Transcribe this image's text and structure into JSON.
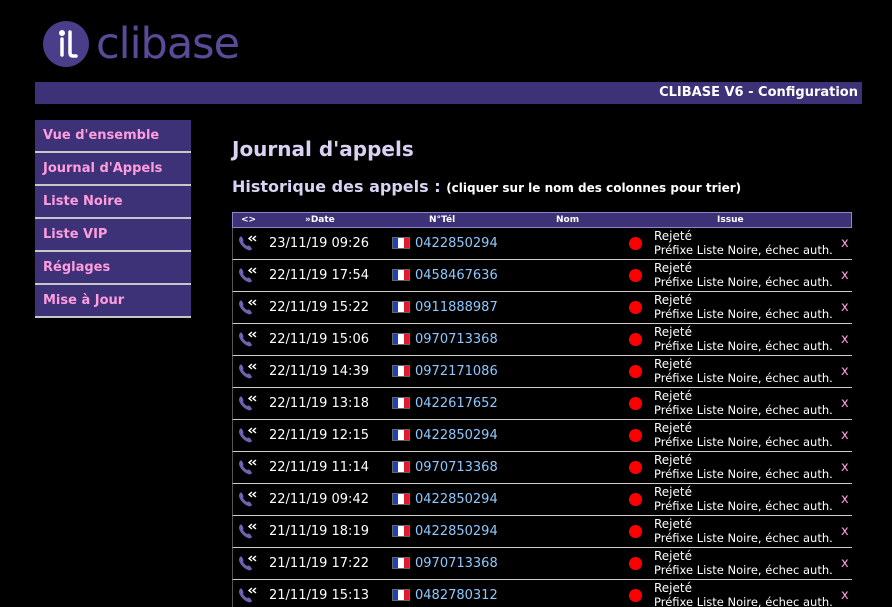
{
  "app": {
    "logo_text": "clibase",
    "title": "CLIBASE V6 - Configuration",
    "accent": "#3d3178",
    "link_pink": "#ff9ddd",
    "number_blue": "#8ec8ff"
  },
  "sidebar": {
    "items": [
      {
        "label": "Vue d'ensemble"
      },
      {
        "label": "Journal d'Appels"
      },
      {
        "label": "Liste Noire"
      },
      {
        "label": "Liste VIP"
      },
      {
        "label": "Réglages"
      },
      {
        "label": "Mise à Jour"
      }
    ]
  },
  "main": {
    "title": "Journal d'appels",
    "subtitle": "Historique des appels :",
    "subtitle_hint": "(cliquer sur le nom des colonnes pour trier)"
  },
  "table": {
    "headers": {
      "direction": "<>",
      "date": "»Date",
      "phone": "N°Tél",
      "name": "Nom",
      "issue": "Issue"
    },
    "rows": [
      {
        "date": "23/11/19 09:26",
        "phone": "0422850294",
        "name": "",
        "status": "Rejeté",
        "detail": "Préfixe Liste Noire, échec auth.",
        "delete": "x"
      },
      {
        "date": "22/11/19 17:54",
        "phone": "0458467636",
        "name": "",
        "status": "Rejeté",
        "detail": "Préfixe Liste Noire, échec auth.",
        "delete": "x"
      },
      {
        "date": "22/11/19 15:22",
        "phone": "0911888987",
        "name": "",
        "status": "Rejeté",
        "detail": "Préfixe Liste Noire, échec auth.",
        "delete": "x"
      },
      {
        "date": "22/11/19 15:06",
        "phone": "0970713368",
        "name": "",
        "status": "Rejeté",
        "detail": "Préfixe Liste Noire, échec auth.",
        "delete": "x"
      },
      {
        "date": "22/11/19 14:39",
        "phone": "0972171086",
        "name": "",
        "status": "Rejeté",
        "detail": "Préfixe Liste Noire, échec auth.",
        "delete": "x"
      },
      {
        "date": "22/11/19 13:18",
        "phone": "0422617652",
        "name": "",
        "status": "Rejeté",
        "detail": "Préfixe Liste Noire, échec auth.",
        "delete": "x"
      },
      {
        "date": "22/11/19 12:15",
        "phone": "0422850294",
        "name": "",
        "status": "Rejeté",
        "detail": "Préfixe Liste Noire, échec auth.",
        "delete": "x"
      },
      {
        "date": "22/11/19 11:14",
        "phone": "0970713368",
        "name": "",
        "status": "Rejeté",
        "detail": "Préfixe Liste Noire, échec auth.",
        "delete": "x"
      },
      {
        "date": "22/11/19 09:42",
        "phone": "0422850294",
        "name": "",
        "status": "Rejeté",
        "detail": "Préfixe Liste Noire, échec auth.",
        "delete": "x"
      },
      {
        "date": "21/11/19 18:19",
        "phone": "0422850294",
        "name": "",
        "status": "Rejeté",
        "detail": "Préfixe Liste Noire, échec auth.",
        "delete": "x"
      },
      {
        "date": "21/11/19 17:22",
        "phone": "0970713368",
        "name": "",
        "status": "Rejeté",
        "detail": "Préfixe Liste Noire, échec auth.",
        "delete": "x"
      },
      {
        "date": "21/11/19 15:13",
        "phone": "0482780312",
        "name": "",
        "status": "Rejeté",
        "detail": "Préfixe Liste Noire, échec auth.",
        "delete": "x"
      }
    ]
  }
}
